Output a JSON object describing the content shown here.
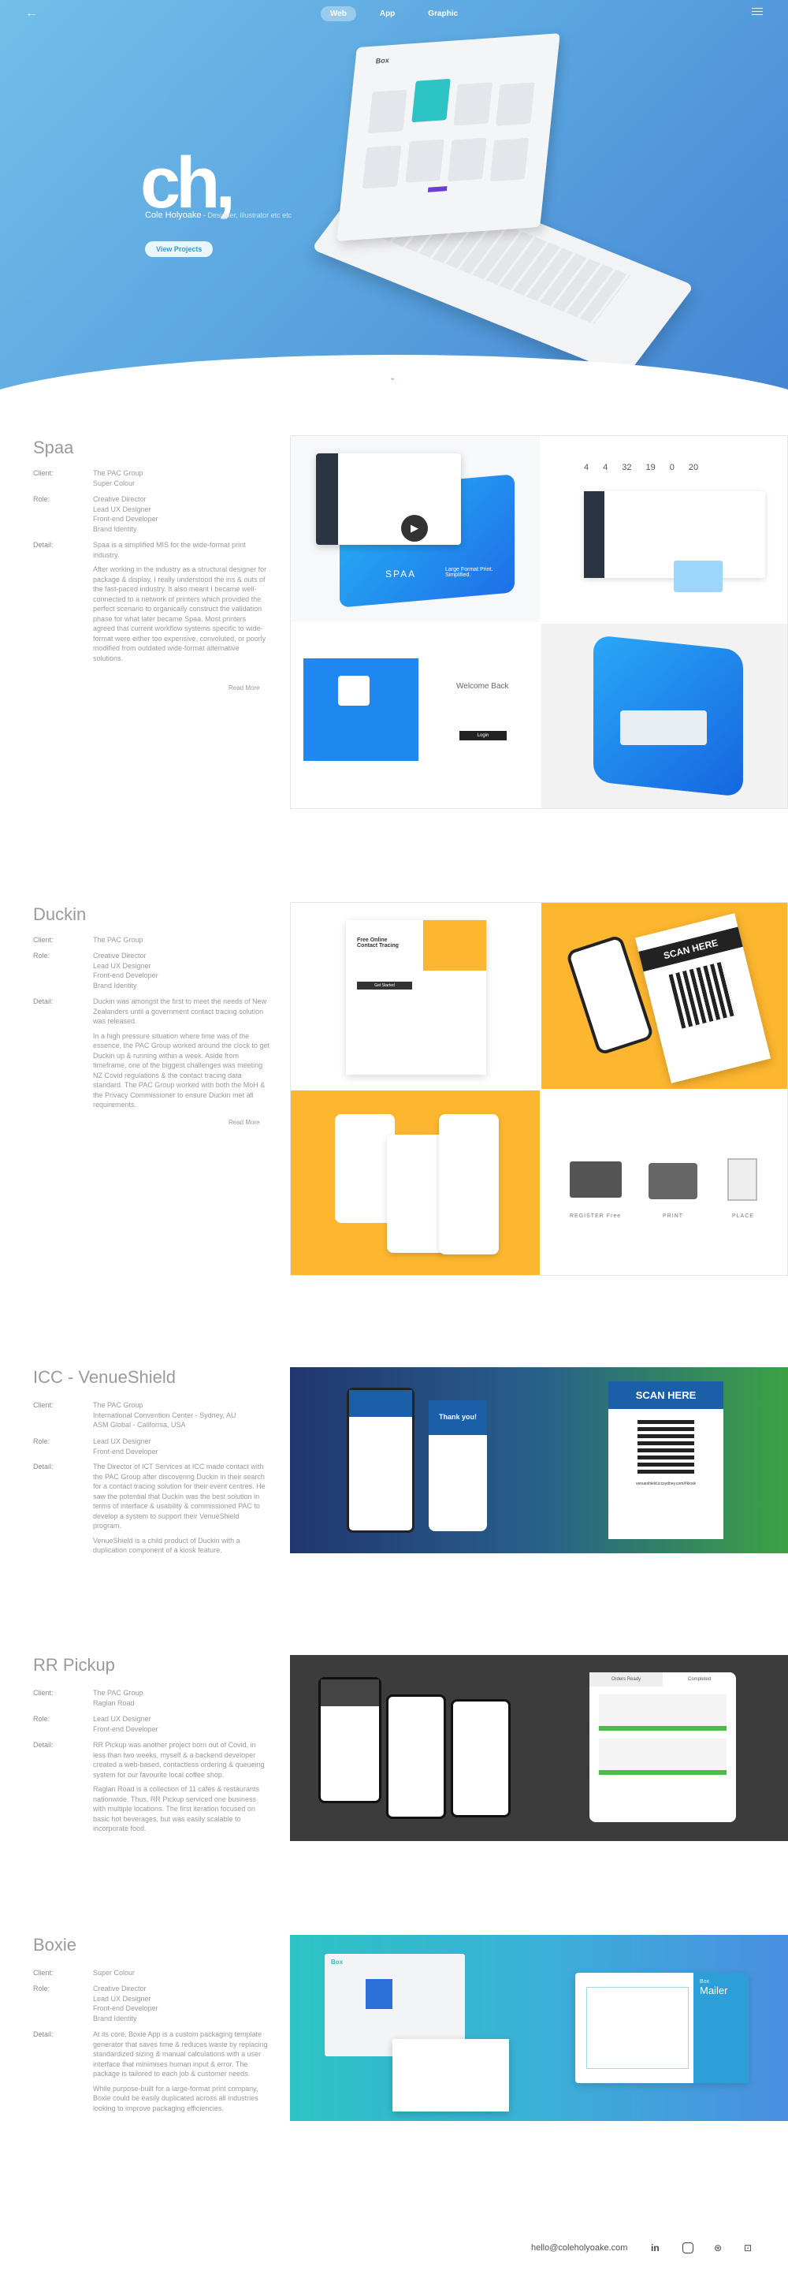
{
  "nav": {
    "back": "←",
    "tabs": [
      "Web",
      "App",
      "Graphic"
    ],
    "active": 0
  },
  "hero": {
    "logo": "ch,",
    "name": "Cole Holyoake",
    "role": " - Designer, Illustrator etc etc",
    "cta": "View Projects",
    "scroll": "⌄"
  },
  "labels": {
    "client": "Client:",
    "role": "Role:",
    "detail": "Detail:",
    "read_more": "Read More"
  },
  "projects": [
    {
      "title": "Spaa",
      "client": [
        "The PAC Group",
        "Super Colour"
      ],
      "role": [
        "Creative Director",
        "Lead UX Designer",
        "Front-end Developer",
        "Brand Identity"
      ],
      "detail": [
        "Spaa is a simplified MIS for the wide-format print industry.",
        "After working in the industry as a structural designer for package & display, I really understood the ins & outs of the fast-paced industry. It also meant I became well-connected to a network of printers which provided the perfect scenario to organically construct the validation phase for what later became Spaa. Most printers agreed that current workflow systems specific to wide-format were either too expensive, convoluted, or poorly modified from outdated wide-format alternative solutions."
      ],
      "read_more": true,
      "screens": {
        "brand": "SPAA",
        "tagline": "Large Format Print. Simplified.",
        "welcome": "Welcome Back",
        "login": "Login",
        "stats": [
          "4",
          "4",
          "32",
          "19",
          "0",
          "20"
        ]
      }
    },
    {
      "title": "Duckin",
      "client": [
        "The PAC Group"
      ],
      "role": [
        "Creative Director",
        "Lead UX Designer",
        "Front-end Developer",
        "Brand Identity"
      ],
      "detail": [
        "Duckin was amongst the first to meet the needs of New Zealanders until a government contact tracing solution was released.",
        "In a high pressure situation where time was of the essence, the PAC Group worked around the clock to get Duckin up & running within a week. Aside from timeframe, one of the biggest challenges was meeting NZ Covid regulations & the contact tracing data standard. The PAC Group worked with both the MoH & the Privacy Commissioner to ensure Duckin met all requirements."
      ],
      "read_more": true,
      "screens": {
        "scan": "SCAN HERE",
        "steps": [
          "REGISTER Free",
          "PRINT",
          "PLACE"
        ],
        "headline": "Free Online Contact Tracing",
        "start": "Get Started"
      }
    },
    {
      "title": "ICC - VenueShield",
      "client": [
        "The PAC Group",
        "International Convention Center - Sydney, AU",
        "ASM Global - California, USA"
      ],
      "role": [
        "Lead UX Designer",
        "Front-end Developer"
      ],
      "detail": [
        "The Director of ICT Services at ICC made contact with the PAC Group after discovering Duckin in their search for a contact tracing solution for their event centres. He saw the potential that Duckin was the best solution in terms of interface & usability & commissioned PAC to develop a system to support their VenueShield program.",
        "VenueShield is a child product of Duckin with a duplication component of a kiosk feature."
      ],
      "read_more": false,
      "screens": {
        "scan": "SCAN HERE",
        "thanks": "Thank you!",
        "url": "venueshield.iccsydney.com/#kiosk"
      }
    },
    {
      "title": "RR Pickup",
      "client": [
        "The PAC Group",
        "Raglan Road"
      ],
      "role": [
        "Lead UX Designer",
        "Front-end Developer"
      ],
      "detail": [
        "RR Pickup was another project born out of Covid, in less than two weeks, myself & a backend developer created a web-based, contactless ordering & queueing system for our favourite local coffee shop.",
        "Raglan Road is a collection of 11 cafes & restaurants nationwide. Thus, RR Pickup serviced one business with multiple locations. The first iteration focused on basic hot beverages, but was easily scalable to incorporate food."
      ],
      "read_more": false,
      "screens": {
        "tabs": [
          "Orders Ready",
          "Completed"
        ]
      }
    },
    {
      "title": "Boxie",
      "client": [
        "Super Colour"
      ],
      "role": [
        "Creative Director",
        "Lead UX Designer",
        "Front-end Developer",
        "Brand Identity"
      ],
      "detail": [
        "At its core, Boxie App is a custom packaging template generator that saves time & reduces waste by replacing standardized sizing & manual calculations with a user interface that minimises human input & error. The package is tailored to each job & customer needs.",
        "While purpose-built for a large-format print company, Boxie could be easily duplicated across all industries looking to improve packaging efficiencies."
      ],
      "read_more": false,
      "screens": {
        "brand": "Box",
        "mailer_top": "Box",
        "mailer": "Mailer"
      }
    }
  ],
  "footer": {
    "email": "hello@coleholyoake.com",
    "icons": [
      "linkedin-icon",
      "instagram-icon",
      "dribbble-icon",
      "cart-icon"
    ]
  },
  "colors": {
    "hero_start": "#72bfe9",
    "hero_end": "#4385d3",
    "spaa_blue": "#1e88f0",
    "duckin_yellow": "#fdb62f",
    "icc_start": "#21366f",
    "icc_end": "#3ca244",
    "rr_bg": "#3c3c3c",
    "boxie_teal": "#2cc3c4"
  }
}
